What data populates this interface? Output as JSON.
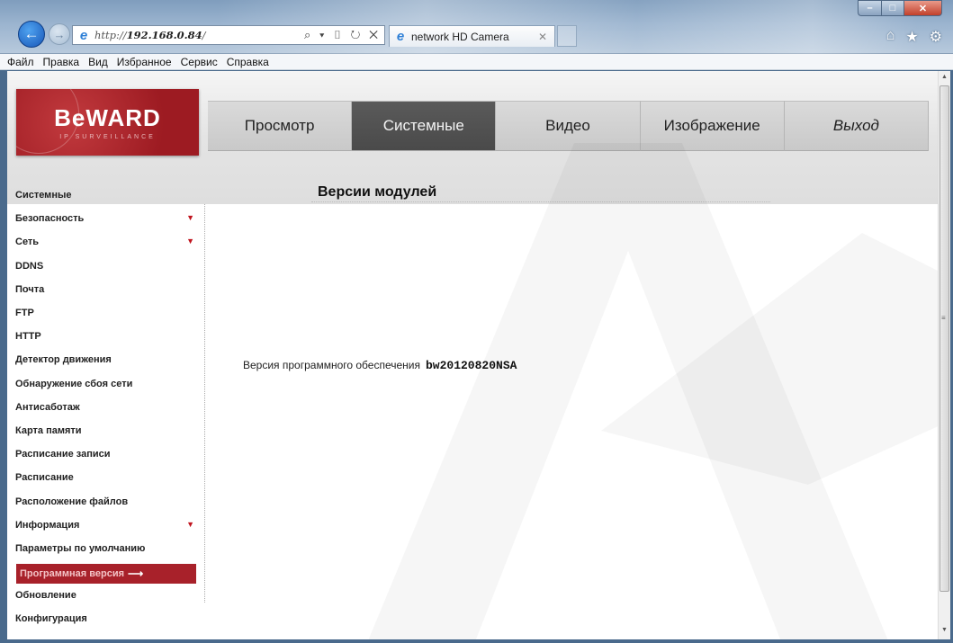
{
  "browser": {
    "url_prefix": "http://",
    "url_host": "192.168.0.84",
    "url_suffix": "/",
    "address_tools": "⌕ ▾ ▯ ↻ ✕",
    "tab_title": "network HD Camera",
    "tab_close": "✕",
    "menu": [
      "Файл",
      "Правка",
      "Вид",
      "Избранное",
      "Сервис",
      "Справка"
    ]
  },
  "logo": {
    "main": "BeWARD",
    "sub": "IP SURVEILLANCE"
  },
  "topnav": [
    {
      "label": "Просмотр",
      "active": false
    },
    {
      "label": "Системные",
      "active": true
    },
    {
      "label": "Видео",
      "active": false
    },
    {
      "label": "Изображение",
      "active": false
    },
    {
      "label": "Выход",
      "active": false
    }
  ],
  "sidebar": [
    {
      "label": "Системные"
    },
    {
      "label": "Безопасность",
      "expandable": true
    },
    {
      "label": "Сеть",
      "expandable": true
    },
    {
      "label": "DDNS"
    },
    {
      "label": "Почта"
    },
    {
      "label": "FTP"
    },
    {
      "label": "HTTP"
    },
    {
      "label": "Детектор движения"
    },
    {
      "label": "Обнаружение сбоя сети"
    },
    {
      "label": "Антисаботаж"
    },
    {
      "label": "Карта памяти"
    },
    {
      "label": "Расписание записи"
    },
    {
      "label": "Расписание"
    },
    {
      "label": "Расположение файлов"
    },
    {
      "label": "Информация",
      "expandable": true
    },
    {
      "label": "Параметры по умолчанию"
    },
    {
      "label": "Программная версия",
      "active": true
    },
    {
      "label": "Обновление"
    },
    {
      "label": "Конфигурация"
    }
  ],
  "content": {
    "title": "Версии модулей",
    "firmware_label": "Версия программного обеспечения",
    "firmware_value": "bw20120820NSA"
  },
  "colors": {
    "accent_red": "#a8212a",
    "nav_active": "#4a4a4a",
    "nav_inactive": "#d0d0d0"
  }
}
